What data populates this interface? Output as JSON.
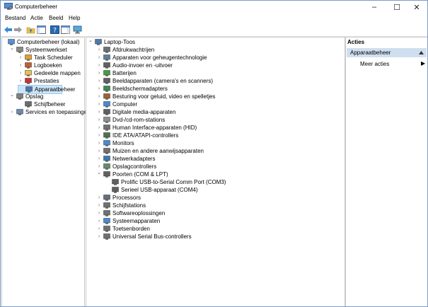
{
  "window": {
    "title": "Computerbeheer"
  },
  "menu": [
    "Bestand",
    "Actie",
    "Beeld",
    "Help"
  ],
  "left_tree": [
    {
      "label": "Computerbeheer (lokaal)",
      "level": 0,
      "arrow": "",
      "icon": "computer-management-icon",
      "color": "#5a8fd6"
    },
    {
      "label": "Systeemwerkset",
      "level": 1,
      "arrow": "v",
      "icon": "tools-icon",
      "color": "#8a8a8a"
    },
    {
      "label": "Task Scheduler",
      "level": 2,
      "arrow": ">",
      "icon": "clock-icon",
      "color": "#e0a030"
    },
    {
      "label": "Logboeken",
      "level": 2,
      "arrow": ">",
      "icon": "event-log-icon",
      "color": "#c06030"
    },
    {
      "label": "Gedeelde mappen",
      "level": 2,
      "arrow": ">",
      "icon": "shared-folder-icon",
      "color": "#e8c050"
    },
    {
      "label": "Prestaties",
      "level": 2,
      "arrow": ">",
      "icon": "performance-icon",
      "color": "#d03030"
    },
    {
      "label": "Apparaatbeheer",
      "level": 2,
      "arrow": "",
      "icon": "device-manager-icon",
      "color": "#4a7ab0",
      "selected": true
    },
    {
      "label": "Opslag",
      "level": 1,
      "arrow": "v",
      "icon": "storage-icon",
      "color": "#808080"
    },
    {
      "label": "Schijfbeheer",
      "level": 2,
      "arrow": "",
      "icon": "disk-icon",
      "color": "#6a6a6a"
    },
    {
      "label": "Services en toepassingen",
      "level": 1,
      "arrow": ">",
      "icon": "services-icon",
      "color": "#6a8ab0"
    }
  ],
  "device_tree": [
    {
      "label": "Laptop-Toos",
      "level": 0,
      "arrow": "v",
      "icon": "laptop-icon",
      "color": "#4a7ab0"
    },
    {
      "label": "Afdrukwachtrijen",
      "level": 1,
      "arrow": ">",
      "icon": "printer-icon",
      "color": "#707070"
    },
    {
      "label": "Apparaten voor geheugentechnologie",
      "level": 1,
      "arrow": ">",
      "icon": "memory-device-icon",
      "color": "#6080a0"
    },
    {
      "label": "Audio-invoer en -uitvoer",
      "level": 1,
      "arrow": ">",
      "icon": "audio-icon",
      "color": "#606060"
    },
    {
      "label": "Batterijen",
      "level": 1,
      "arrow": ">",
      "icon": "battery-icon",
      "color": "#40a040"
    },
    {
      "label": "Beeldapparaten (camera's en scanners)",
      "level": 1,
      "arrow": ">",
      "icon": "camera-icon",
      "color": "#606060"
    },
    {
      "label": "Beeldschermadapters",
      "level": 1,
      "arrow": ">",
      "icon": "display-adapter-icon",
      "color": "#3a8a50"
    },
    {
      "label": "Besturing voor geluid, video en spelletjes",
      "level": 1,
      "arrow": ">",
      "icon": "sound-icon",
      "color": "#a06030"
    },
    {
      "label": "Computer",
      "level": 1,
      "arrow": ">",
      "icon": "computer-icon",
      "color": "#4a8ad0"
    },
    {
      "label": "Digitale media-apparaten",
      "level": 1,
      "arrow": ">",
      "icon": "media-device-icon",
      "color": "#606060"
    },
    {
      "label": "Dvd-/cd-rom-stations",
      "level": 1,
      "arrow": ">",
      "icon": "optical-drive-icon",
      "color": "#909090"
    },
    {
      "label": "Human Interface-apparaten (HID)",
      "level": 1,
      "arrow": ">",
      "icon": "hid-icon",
      "color": "#707070"
    },
    {
      "label": "IDE ATA/ATAPI-controllers",
      "level": 1,
      "arrow": ">",
      "icon": "ide-controller-icon",
      "color": "#507050"
    },
    {
      "label": "Monitors",
      "level": 1,
      "arrow": ">",
      "icon": "monitor-icon",
      "color": "#4a8ad0"
    },
    {
      "label": "Muizen en andere aanwijsapparaten",
      "level": 1,
      "arrow": ">",
      "icon": "mouse-icon",
      "color": "#707070"
    },
    {
      "label": "Netwerkadapters",
      "level": 1,
      "arrow": ">",
      "icon": "network-adapter-icon",
      "color": "#3a7ab0"
    },
    {
      "label": "Opslagcontrollers",
      "level": 1,
      "arrow": ">",
      "icon": "storage-controller-icon",
      "color": "#6a8a6a"
    },
    {
      "label": "Poorten (COM & LPT)",
      "level": 1,
      "arrow": "v",
      "icon": "port-icon",
      "color": "#606060"
    },
    {
      "label": "Prolific USB-to-Serial Comm Port (COM3)",
      "level": 2,
      "arrow": "",
      "icon": "port-icon",
      "color": "#606060"
    },
    {
      "label": "Serieel USB-apparaat (COM4)",
      "level": 2,
      "arrow": "",
      "icon": "port-icon",
      "color": "#606060"
    },
    {
      "label": "Processors",
      "level": 1,
      "arrow": ">",
      "icon": "processor-icon",
      "color": "#607080"
    },
    {
      "label": "Schijfstations",
      "level": 1,
      "arrow": ">",
      "icon": "disk-drive-icon",
      "color": "#707070"
    },
    {
      "label": "Softwareoplossingen",
      "level": 1,
      "arrow": ">",
      "icon": "software-component-icon",
      "color": "#707070"
    },
    {
      "label": "Systeemapparaten",
      "level": 1,
      "arrow": ">",
      "icon": "system-device-icon",
      "color": "#4a8ad0"
    },
    {
      "label": "Toetsenborden",
      "level": 1,
      "arrow": ">",
      "icon": "keyboard-icon",
      "color": "#707070"
    },
    {
      "label": "Universal Serial Bus-controllers",
      "level": 1,
      "arrow": ">",
      "icon": "usb-controller-icon",
      "color": "#707070"
    }
  ],
  "actions": {
    "header": "Acties",
    "section": "Apparaatbeheer",
    "item": "Meer acties"
  },
  "colors": {
    "selection": "#cce4f7",
    "actions_band": "#cfdff0",
    "border": "#7a9cc6"
  }
}
